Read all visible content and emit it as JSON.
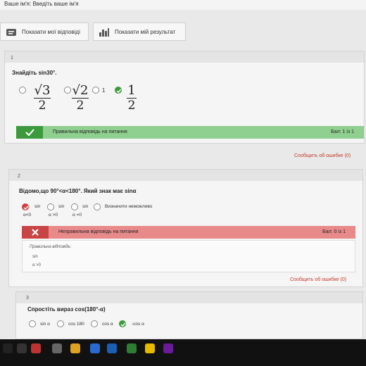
{
  "header": {
    "name_label": "Ваше ім'я: Введіть ваше ім'я"
  },
  "toolbar": {
    "show_answers": "Показати мої відповіді",
    "show_result": "Показати мій результат"
  },
  "questions": [
    {
      "number": "1",
      "text": "Знайдіть sin30°.",
      "options": [
        {
          "num": "√3",
          "den": "2",
          "type": "fraction-root"
        },
        {
          "num": "√2",
          "den": "2",
          "type": "fraction-root"
        },
        {
          "label": "1",
          "type": "plain"
        },
        {
          "num": "1",
          "den": "2",
          "type": "fraction"
        }
      ],
      "result_text": "Правильна відповідь на питання",
      "score": "Бал: 1 із 1",
      "result_color": "#5cb85c",
      "report": "Сообщить об ошибке (0)"
    },
    {
      "number": "2",
      "text": "Відомо,що 90°<α<180°. Який знак має sinα",
      "options": [
        {
          "line1": "sin",
          "line2": "α<0"
        },
        {
          "line1": "sin",
          "line2": "α >0"
        },
        {
          "line1": "sin",
          "line2": "α =0"
        },
        {
          "line1": "Визначити неможливо",
          "line2": ""
        }
      ],
      "result_text": "Неправильна відповідь на питання",
      "score": "Бал: 0 із 1",
      "result_color": "#d9534f",
      "correct_label": "Правильна відповідь:",
      "correct_line1": "sin",
      "correct_line2": "α >0",
      "report": "Сообщить об ошибке (0)"
    },
    {
      "number": "3",
      "text": "Спростіть вираз cos(180°-α)",
      "options": [
        {
          "label": "sin α"
        },
        {
          "label": "cos 180"
        },
        {
          "label": "cos α"
        },
        {
          "label": "-cos α"
        }
      ]
    }
  ]
}
